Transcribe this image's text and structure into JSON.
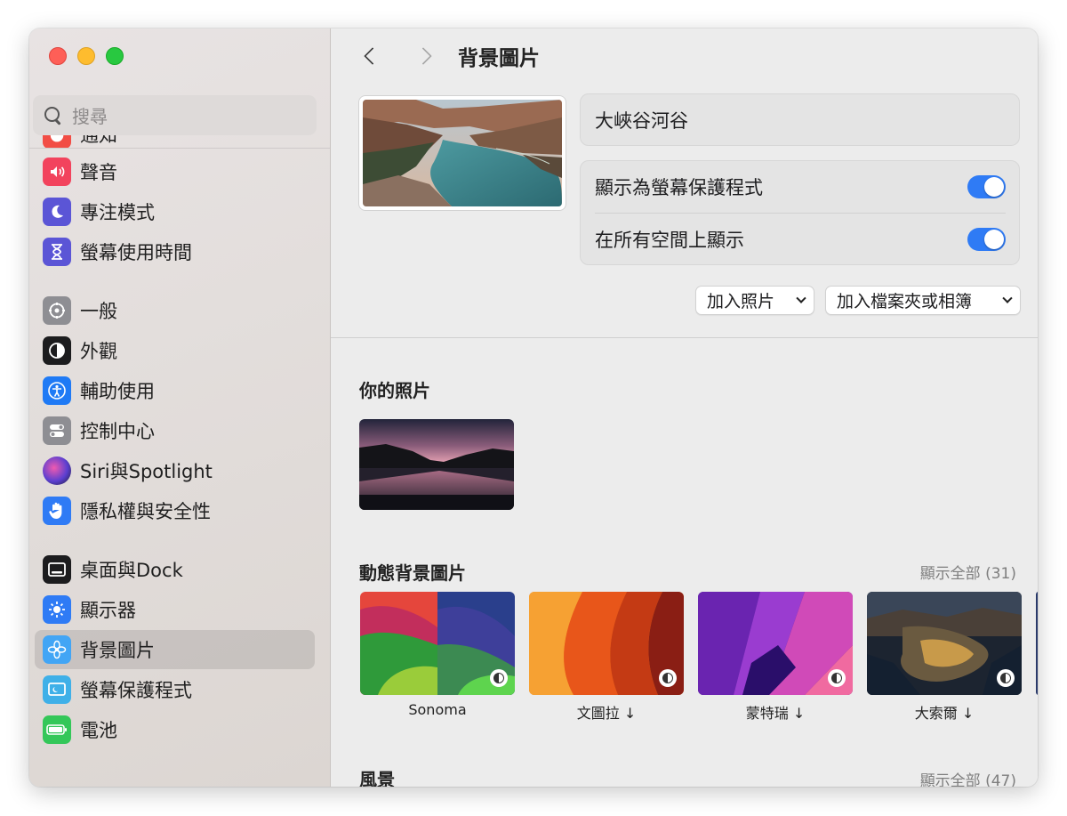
{
  "sidebar": {
    "search_placeholder": "搜尋",
    "items": [
      {
        "label": "通知",
        "icon": "bell-icon",
        "color": "#f24d45"
      },
      {
        "label": "聲音",
        "icon": "speaker-icon",
        "color": "#f2435d"
      },
      {
        "label": "專注模式",
        "icon": "moon-icon",
        "color": "#5b55d6"
      },
      {
        "label": "螢幕使用時間",
        "icon": "hourglass-icon",
        "color": "#5b55d6"
      },
      {
        "label": "一般",
        "icon": "gear-icon",
        "color": "#8e8e93"
      },
      {
        "label": "外觀",
        "icon": "appearance-icon",
        "color": "#1c1c1e"
      },
      {
        "label": "輔助使用",
        "icon": "accessibility-icon",
        "color": "#1f7af5"
      },
      {
        "label": "控制中心",
        "icon": "toggles-icon",
        "color": "#8e8e93"
      },
      {
        "label": "Siri與Spotlight",
        "icon": "siri-icon",
        "color": "#7b3fc8"
      },
      {
        "label": "隱私權與安全性",
        "icon": "hand-icon",
        "color": "#2f7bf5"
      },
      {
        "label": "桌面與Dock",
        "icon": "dock-icon",
        "color": "#1c1c1e"
      },
      {
        "label": "顯示器",
        "icon": "sun-icon",
        "color": "#2f7bf5"
      },
      {
        "label": "背景圖片",
        "icon": "flower-icon",
        "color": "#42a5f5"
      },
      {
        "label": "螢幕保護程式",
        "icon": "screensaver-icon",
        "color": "#3fb0e8"
      },
      {
        "label": "電池",
        "icon": "battery-icon",
        "color": "#34c759"
      }
    ],
    "active_index": 12
  },
  "header": {
    "title": "背景圖片"
  },
  "current": {
    "name": "大峽谷河谷",
    "options": [
      {
        "label": "顯示為螢幕保護程式",
        "enabled": true
      },
      {
        "label": "在所有空間上顯示",
        "enabled": true
      }
    ],
    "add_photo_label": "加入照片",
    "add_folder_label": "加入檔案夾或相簿"
  },
  "sections": {
    "your_photos": {
      "title": "你的照片"
    },
    "dynamic": {
      "title": "動態背景圖片",
      "show_all": "顯示全部 (31)",
      "items": [
        {
          "label": "Sonoma"
        },
        {
          "label": "文圖拉 ↓"
        },
        {
          "label": "蒙特瑞 ↓"
        },
        {
          "label": "大索爾 ↓"
        }
      ]
    },
    "landscape": {
      "title": "風景",
      "show_all": "顯示全部 (47)"
    }
  },
  "accent_color": "#2f7bf5"
}
